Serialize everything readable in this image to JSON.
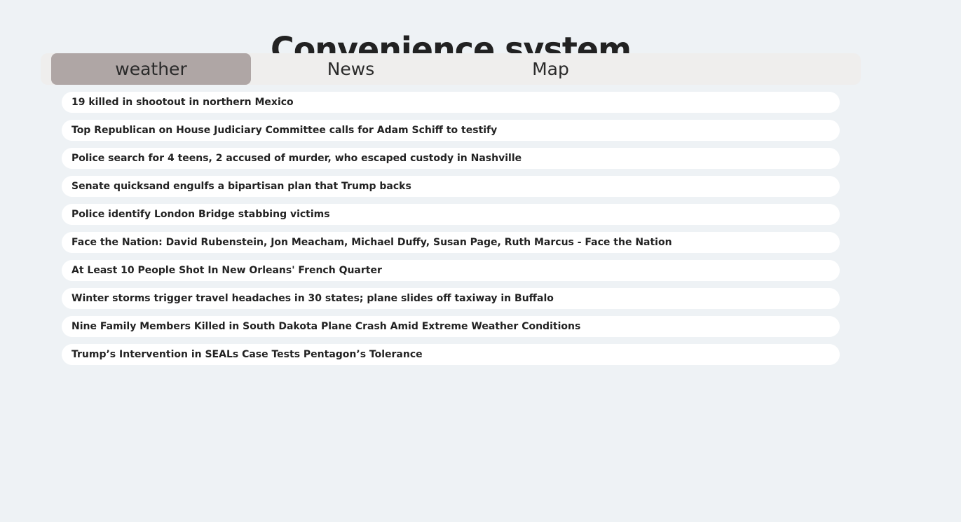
{
  "header": {
    "title": "Convenience system"
  },
  "tabs": [
    {
      "label": "weather",
      "active": true
    },
    {
      "label": "News",
      "active": false
    },
    {
      "label": "Map",
      "active": false
    }
  ],
  "news": {
    "items": [
      "19 killed in shootout in northern Mexico",
      "Top Republican on House Judiciary Committee calls for Adam Schiff to testify",
      "Police search for 4 teens, 2 accused of murder, who escaped custody in Nashville",
      "Senate quicksand engulfs a bipartisan plan that Trump backs",
      "Police identify London Bridge stabbing victims",
      "Face the Nation: David Rubenstein, Jon Meacham, Michael Duffy, Susan Page, Ruth Marcus - Face the Nation",
      "At Least 10 People Shot In New Orleans' French Quarter",
      "Winter storms trigger travel headaches in 30 states; plane slides off taxiway in Buffalo",
      "Nine Family Members Killed in South Dakota Plane Crash Amid Extreme Weather Conditions",
      "Trump’s Intervention in SEALs Case Tests Pentagon’s Tolerance"
    ]
  },
  "colors": {
    "background": "#eef2f5",
    "tab_bar": "#efeeed",
    "active_tab": "#afa6a5",
    "item_background": "#ffffff"
  }
}
